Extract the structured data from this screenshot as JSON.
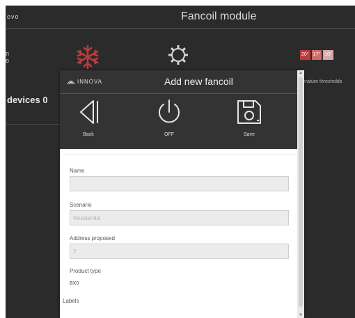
{
  "background": {
    "logo_text": "ovo",
    "title": "Fancoil module",
    "left_fragment_1": "n",
    "left_fragment_2": "o",
    "temps": [
      {
        "label": "20°",
        "color": "#c0393b"
      },
      {
        "label": "17°",
        "color": "#d06a6a"
      },
      {
        "label": "10°",
        "color": "#d8a8a8"
      }
    ],
    "threshold_text": "perature thresholds",
    "devices_label": "devices 0"
  },
  "modal": {
    "logo_text": "INNOVA",
    "title": "Add new fancoil",
    "toolbar": {
      "back_label": "Back",
      "off_label": "OFF",
      "save_label": "Save"
    },
    "fields": {
      "name_label": "Name",
      "name_value": "",
      "scenario_label": "Scenario",
      "scenario_value": "Residential",
      "address_label": "Address proposed",
      "address_value": "2",
      "product_type_label": "Product type",
      "product_type_value": "BX0",
      "labels_label": "Labels"
    }
  },
  "colors": {
    "snowflake": "#c0393b",
    "dark_bg": "#2b2b2b",
    "toolbar_bg": "#333333"
  },
  "icons": [
    "snowflake-icon",
    "gear-icon",
    "back-icon",
    "power-icon",
    "save-icon",
    "innova-logo-icon"
  ]
}
